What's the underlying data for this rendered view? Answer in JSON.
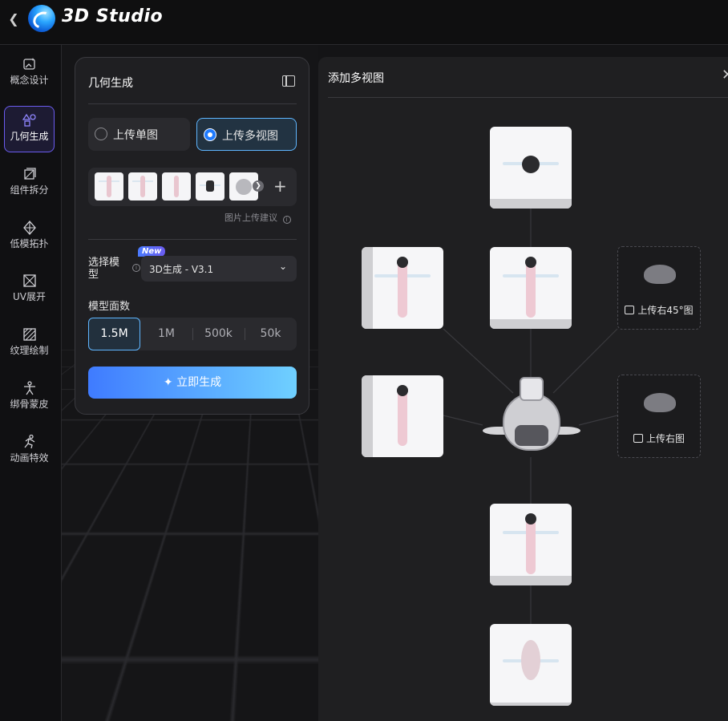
{
  "app": {
    "title": "3D Studio",
    "back_icon": "chevron-left-icon"
  },
  "sidebar": {
    "items": [
      {
        "label": "概念设计",
        "icon": "image-sparkle-icon",
        "active": false
      },
      {
        "label": "几何生成",
        "icon": "shapes-icon",
        "active": true
      },
      {
        "label": "组件拆分",
        "icon": "layers-icon",
        "active": false
      },
      {
        "label": "低模拓扑",
        "icon": "diamond-mesh-icon",
        "active": false
      },
      {
        "label": "UV展开",
        "icon": "uv-unwrap-icon",
        "active": false
      },
      {
        "label": "纹理绘制",
        "icon": "texture-brush-icon",
        "active": false
      },
      {
        "label": "绑骨蒙皮",
        "icon": "person-rig-icon",
        "active": false
      },
      {
        "label": "动画特效",
        "icon": "running-person-icon",
        "active": false
      }
    ]
  },
  "panel": {
    "title": "几何生成",
    "upload_options": [
      {
        "label": "上传单图",
        "selected": false
      },
      {
        "label": "上传多视图",
        "selected": true
      }
    ],
    "thumbnail_count": 5,
    "upload_hint": "图片上传建议",
    "model_label": "选择模型",
    "new_badge": "New",
    "model_value": "3D生成 - V3.1",
    "faces_label": "模型面数",
    "face_options": [
      "1.5M",
      "1M",
      "500k",
      "50k"
    ],
    "face_selected": "1.5M",
    "generate_button": "立即生成"
  },
  "multiview": {
    "title": "添加多视图",
    "slots": [
      {
        "label": "上传右45°图"
      },
      {
        "label": "上传右图"
      }
    ]
  },
  "colors": {
    "accent_blue": "#5fb6ff",
    "accent_purple": "#6b5cf0",
    "button_gradient_start": "#3f7bff",
    "button_gradient_end": "#6fd0ff"
  }
}
